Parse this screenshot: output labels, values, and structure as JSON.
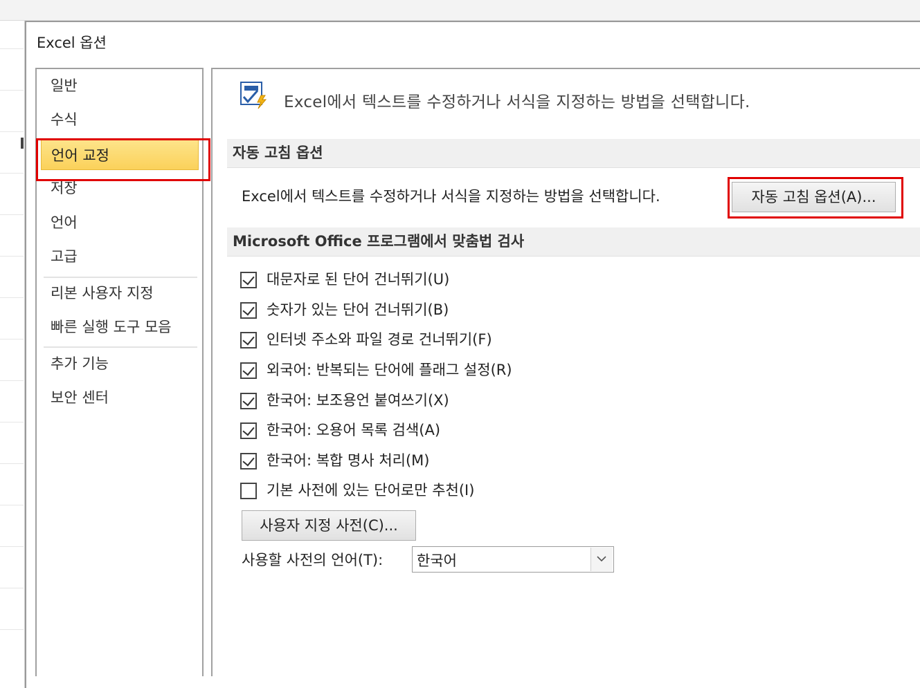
{
  "dialog": {
    "title": "Excel 옵션"
  },
  "nav": {
    "items": [
      {
        "label": "일반"
      },
      {
        "label": "수식"
      },
      {
        "label": "언어 교정"
      },
      {
        "label": "저장"
      },
      {
        "label": "언어"
      },
      {
        "label": "고급"
      },
      {
        "label": "리본 사용자 지정"
      },
      {
        "label": "빠른 실행 도구 모음"
      },
      {
        "label": "추가 기능"
      },
      {
        "label": "보안 센터"
      }
    ],
    "selected": "언어 교정"
  },
  "content": {
    "header_text": "Excel에서 텍스트를 수정하거나 서식을 지정하는 방법을 선택합니다.",
    "header_icon": "autocorrect-abc-check-icon",
    "autocorrect": {
      "section_title": "자동 고침 옵션",
      "description": "Excel에서 텍스트를 수정하거나 서식을 지정하는 방법을 선택합니다.",
      "button_label": "자동 고침 옵션(A)..."
    },
    "spelling": {
      "section_title": "Microsoft Office 프로그램에서 맞춤법 검사",
      "options": [
        {
          "label": "대문자로 된 단어 건너뛰기(U)",
          "checked": true
        },
        {
          "label": "숫자가 있는 단어 건너뛰기(B)",
          "checked": true
        },
        {
          "label": "인터넷 주소와 파일 경로 건너뛰기(F)",
          "checked": true
        },
        {
          "label": "외국어: 반복되는 단어에 플래그 설정(R)",
          "checked": true
        },
        {
          "label": "한국어: 보조용언 붙여쓰기(X)",
          "checked": true
        },
        {
          "label": "한국어: 오용어 목록 검색(A)",
          "checked": true
        },
        {
          "label": "한국어: 복합 명사 처리(M)",
          "checked": true
        },
        {
          "label": "기본 사전에 있는 단어로만 추천(I)",
          "checked": false
        }
      ],
      "custom_dict_button": "사용자 지정 사전(C)...",
      "dict_language_label": "사용할 사전의 언어(T):",
      "dict_language_value": "한국어"
    }
  },
  "colors": {
    "highlight": "#e00000",
    "selected_nav": "#fbd15a"
  }
}
